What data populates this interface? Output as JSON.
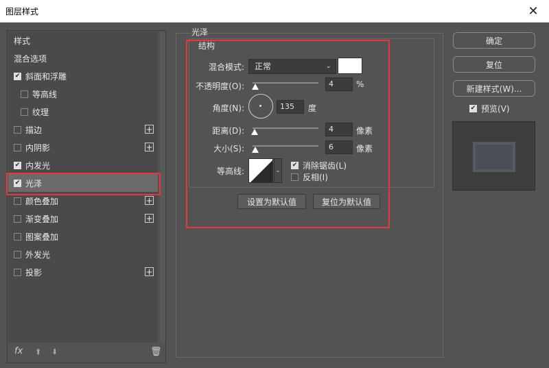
{
  "window": {
    "title": "图层样式",
    "close_glyph": "✕"
  },
  "styles_list": {
    "items": [
      {
        "label": "样式",
        "checkbox": false,
        "checked": false,
        "plus": false,
        "indent": false,
        "selected": false
      },
      {
        "label": "混合选项",
        "checkbox": false,
        "checked": false,
        "plus": false,
        "indent": false,
        "selected": false
      },
      {
        "label": "斜面和浮雕",
        "checkbox": true,
        "checked": true,
        "plus": false,
        "indent": false,
        "selected": false
      },
      {
        "label": "等高线",
        "checkbox": true,
        "checked": false,
        "plus": false,
        "indent": true,
        "selected": false
      },
      {
        "label": "纹理",
        "checkbox": true,
        "checked": false,
        "plus": false,
        "indent": true,
        "selected": false
      },
      {
        "label": "描边",
        "checkbox": true,
        "checked": false,
        "plus": true,
        "indent": false,
        "selected": false
      },
      {
        "label": "内阴影",
        "checkbox": true,
        "checked": false,
        "plus": true,
        "indent": false,
        "selected": false
      },
      {
        "label": "内发光",
        "checkbox": true,
        "checked": true,
        "plus": false,
        "indent": false,
        "selected": false
      },
      {
        "label": "光泽",
        "checkbox": true,
        "checked": true,
        "plus": false,
        "indent": false,
        "selected": true
      },
      {
        "label": "颜色叠加",
        "checkbox": true,
        "checked": false,
        "plus": true,
        "indent": false,
        "selected": false
      },
      {
        "label": "渐变叠加",
        "checkbox": true,
        "checked": false,
        "plus": true,
        "indent": false,
        "selected": false
      },
      {
        "label": "图案叠加",
        "checkbox": true,
        "checked": false,
        "plus": false,
        "indent": false,
        "selected": false
      },
      {
        "label": "外发光",
        "checkbox": true,
        "checked": false,
        "plus": false,
        "indent": false,
        "selected": false
      },
      {
        "label": "投影",
        "checkbox": true,
        "checked": false,
        "plus": true,
        "indent": false,
        "selected": false
      }
    ],
    "footer": {
      "fx": "fx",
      "up": "⬆",
      "down": "⬇",
      "trash": "🗑"
    }
  },
  "satin": {
    "section_title": "光泽",
    "structure_title": "结构",
    "blend_mode": {
      "label": "混合模式:",
      "value": "正常",
      "swatch_color": "#ffffff"
    },
    "opacity": {
      "label": "不透明度(O):",
      "value": "4",
      "unit": "%",
      "slider_fraction": 0.04
    },
    "angle": {
      "label": "角度(N):",
      "value": "135",
      "unit": "度"
    },
    "distance": {
      "label": "距离(D):",
      "value": "4",
      "unit": "像素",
      "slider_fraction": 0.03
    },
    "size": {
      "label": "大小(S):",
      "value": "6",
      "unit": "像素",
      "slider_fraction": 0.04
    },
    "contour": {
      "label": "等高线:",
      "anti_alias": {
        "label": "消除锯齿(L)",
        "checked": true
      },
      "invert": {
        "label": "反相(I)",
        "checked": false
      }
    },
    "buttons": {
      "make_default": "设置为默认值",
      "reset_default": "复位为默认值"
    }
  },
  "right": {
    "ok": "确定",
    "reset": "复位",
    "new_style": "新建样式(W)...",
    "preview": {
      "label": "预览(V)",
      "checked": true
    }
  },
  "colors": {
    "highlight": "#e53935",
    "panel": "#535353"
  }
}
